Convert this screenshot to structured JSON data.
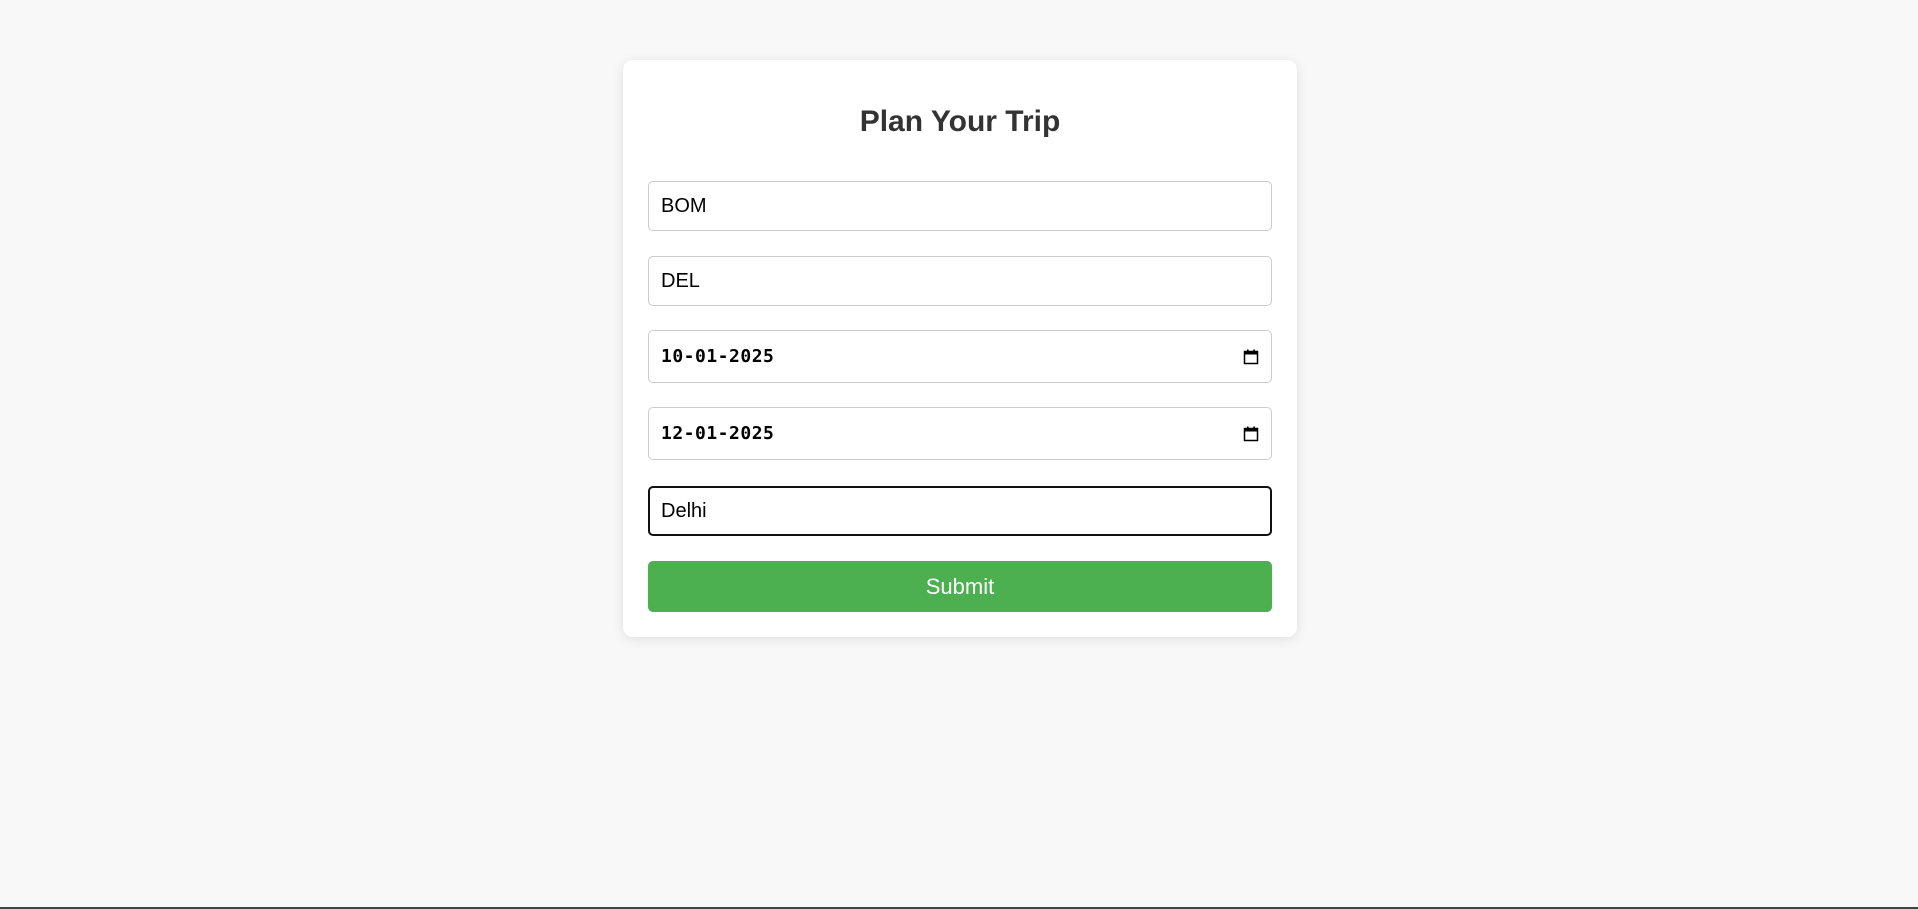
{
  "form": {
    "title": "Plan Your Trip",
    "origin_value": "BOM",
    "destination_value": "DEL",
    "depart_date": "10-01-2025",
    "return_date": "12-01-2025",
    "city_value": "Delhi",
    "submit_label": "Submit"
  },
  "icons": {
    "depart_date_icon": "calendar-icon",
    "return_date_icon": "calendar-icon"
  },
  "colors": {
    "page_background": "#f8f8f8",
    "card_background": "#ffffff",
    "title_text": "#333333",
    "submit_background": "#4caf50",
    "submit_text": "#ffffff",
    "field_border": "#cccccc",
    "focused_border": "#111111"
  }
}
